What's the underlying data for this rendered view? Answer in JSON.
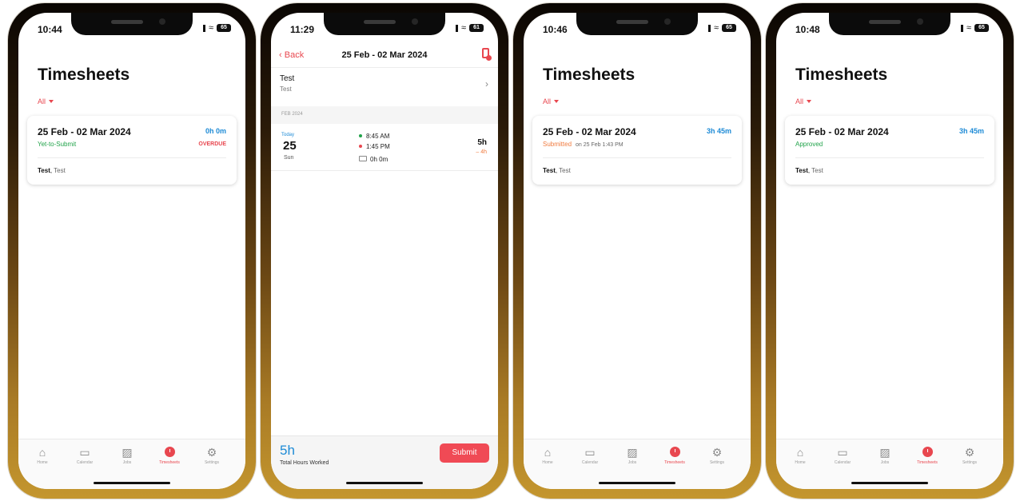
{
  "phones": [
    {
      "time": "10:44",
      "battery": "65",
      "title": "Timesheets",
      "filter": "All",
      "card": {
        "range": "25 Feb - 02 Mar 2024",
        "hours": "0h 0m",
        "status": "Yet-to-Submit",
        "status_color": "#21a34a",
        "overdue": "OVERDUE",
        "user_bold": "Test",
        "user_rest": "Test"
      }
    },
    {
      "time": "11:29",
      "battery": "61",
      "back": "Back",
      "nav_title": "25 Feb - 02 Mar 2024",
      "employee": "Test",
      "employee_sub": "Test",
      "section": "FEB 2024",
      "entry": {
        "today": "Today",
        "day": "25",
        "dow": "Sun",
        "in_time": "8:45 AM",
        "out_time": "1:45 PM",
        "break": "0h 0m",
        "total": "5h",
        "diff": "– 4h"
      },
      "footer_total": "5h",
      "footer_label": "Total Hours Worked",
      "submit": "Submit"
    },
    {
      "time": "10:46",
      "battery": "65",
      "title": "Timesheets",
      "filter": "All",
      "card": {
        "range": "25 Feb - 02 Mar 2024",
        "hours": "3h 45m",
        "status": "Submitted",
        "status_color": "#f07b3f",
        "status_sub": "on 25 Feb 1:43 PM",
        "user_bold": "Test",
        "user_rest": "Test"
      }
    },
    {
      "time": "10:48",
      "battery": "65",
      "title": "Timesheets",
      "filter": "All",
      "card": {
        "range": "25 Feb - 02 Mar 2024",
        "hours": "3h 45m",
        "status": "Approved",
        "status_color": "#21a34a",
        "user_bold": "Test",
        "user_rest": "Test"
      }
    }
  ],
  "tabs": [
    {
      "label": "Home",
      "icon": "home-icon"
    },
    {
      "label": "Calendar",
      "icon": "calendar-icon"
    },
    {
      "label": "Jobs",
      "icon": "briefcase-icon"
    },
    {
      "label": "Timesheets",
      "icon": "clock-icon"
    },
    {
      "label": "Settings",
      "icon": "gear-icon"
    }
  ],
  "colors": {
    "accent": "#e8474f",
    "blue": "#1e8bd6",
    "green": "#21a34a",
    "orange": "#f07b3f"
  }
}
